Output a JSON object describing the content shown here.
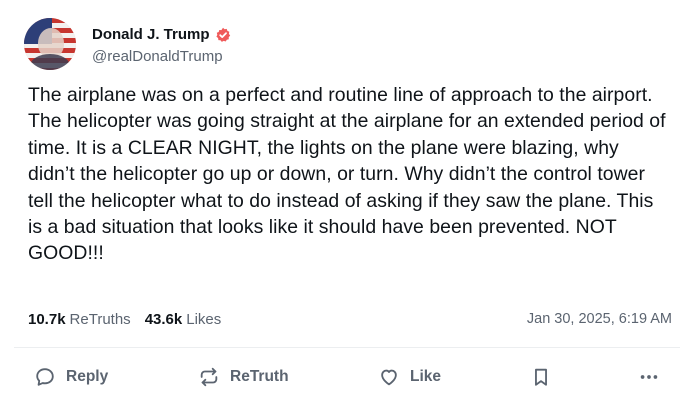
{
  "author": {
    "display_name": "Donald J. Trump",
    "handle": "@realDonaldTrump",
    "verified": true
  },
  "post": {
    "text": "The airplane was on a perfect and routine line of approach to the airport. The helicopter was going straight at the airplane for an extended period of time. It is a CLEAR NIGHT, the lights on the plane were blazing, why didn’t the helicopter go up or down, or turn. Why didn’t the control tower tell the helicopter what to do instead of asking if they saw the plane. This is a bad situation that looks like it should have been prevented. NOT GOOD!!!",
    "retruths_count": "10.7k",
    "retruths_label": "ReTruths",
    "likes_count": "43.6k",
    "likes_label": "Likes",
    "timestamp": "Jan 30, 2025, 6:19 AM"
  },
  "actions": {
    "reply_label": "Reply",
    "retruth_label": "ReTruth",
    "like_label": "Like"
  },
  "colors": {
    "verified_badge": "#ef5a5a",
    "secondary_text": "#5b6470",
    "primary_text": "#0f1419",
    "divider": "#eceef0"
  },
  "icons": {
    "reply": "speech-bubble-icon",
    "retruth": "repost-arrows-icon",
    "like": "heart-icon",
    "bookmark": "bookmark-icon",
    "more": "more-dots-icon"
  }
}
